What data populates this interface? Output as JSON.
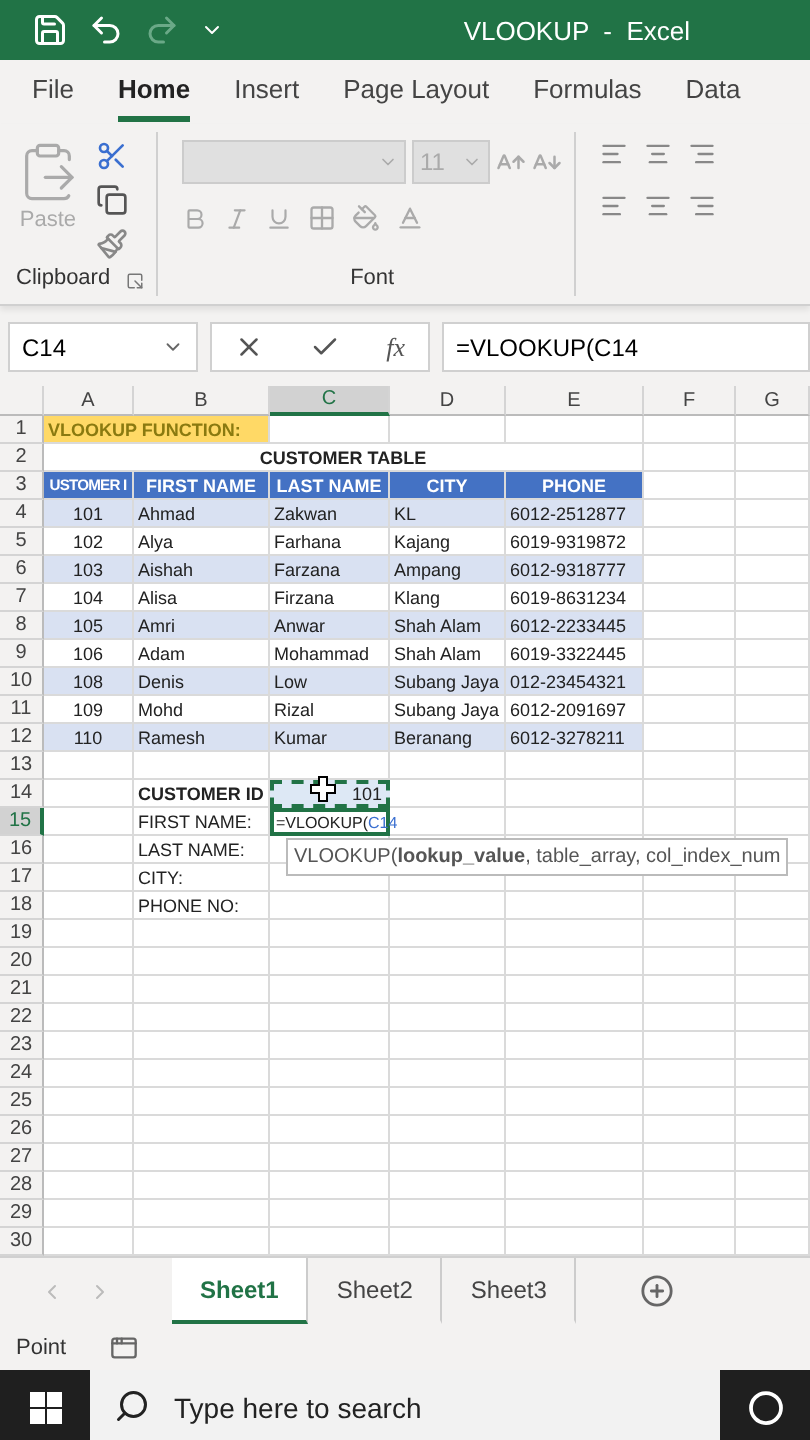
{
  "window": {
    "title": "VLOOKUP  -  Excel"
  },
  "ribbon_tabs": [
    {
      "label": "File",
      "selected": false
    },
    {
      "label": "Home",
      "selected": true
    },
    {
      "label": "Insert",
      "selected": false
    },
    {
      "label": "Page Layout",
      "selected": false
    },
    {
      "label": "Formulas",
      "selected": false
    },
    {
      "label": "Data",
      "selected": false
    }
  ],
  "ribbon": {
    "clipboard": {
      "paste_label": "Paste",
      "group_label": "Clipboard"
    },
    "font": {
      "font_size": "11",
      "group_label": "Font",
      "disabled": true
    }
  },
  "formula_bar": {
    "name_box": "C14",
    "function_label": "fx",
    "formula": "=VLOOKUP(C14"
  },
  "columns": [
    {
      "label": "A",
      "selected": false
    },
    {
      "label": "B",
      "selected": false
    },
    {
      "label": "C",
      "selected": true
    },
    {
      "label": "D",
      "selected": false
    },
    {
      "label": "E",
      "selected": false
    },
    {
      "label": "F",
      "selected": false
    },
    {
      "label": "G",
      "selected": false
    }
  ],
  "rows": [
    {
      "number": "1",
      "kind": "note",
      "selected": false,
      "text": "VLOOKUP FUNCTION:"
    },
    {
      "number": "2",
      "kind": "title",
      "selected": false,
      "text": "CUSTOMER TABLE"
    },
    {
      "number": "3",
      "kind": "header",
      "selected": false,
      "cells": [
        "USTOMER I",
        "FIRST NAME",
        "LAST NAME",
        "CITY",
        "PHONE"
      ]
    },
    {
      "number": "4",
      "kind": "record",
      "selected": false,
      "cells": [
        "101",
        "Ahmad",
        "Zakwan",
        "KL",
        "6012-2512877"
      ]
    },
    {
      "number": "5",
      "kind": "record",
      "selected": false,
      "cells": [
        "102",
        "Alya",
        "Farhana",
        "Kajang",
        "6019-9319872"
      ]
    },
    {
      "number": "6",
      "kind": "record",
      "selected": false,
      "cells": [
        "103",
        "Aishah",
        "Farzana",
        "Ampang",
        "6012-9318777"
      ]
    },
    {
      "number": "7",
      "kind": "record",
      "selected": false,
      "cells": [
        "104",
        "Alisa",
        "Firzana",
        "Klang",
        "6019-8631234"
      ]
    },
    {
      "number": "8",
      "kind": "record",
      "selected": false,
      "cells": [
        "105",
        "Amri",
        "Anwar",
        "Shah Alam",
        "6012-2233445"
      ]
    },
    {
      "number": "9",
      "kind": "record",
      "selected": false,
      "cells": [
        "106",
        "Adam",
        "Mohammad",
        "Shah Alam",
        "6019-3322445"
      ]
    },
    {
      "number": "10",
      "kind": "record",
      "selected": false,
      "cells": [
        "108",
        "Denis",
        "Low",
        "Subang Jaya",
        "012-23454321"
      ]
    },
    {
      "number": "11",
      "kind": "record",
      "selected": false,
      "cells": [
        "109",
        "Mohd",
        "Rizal",
        "Subang Jaya",
        "6012-2091697"
      ]
    },
    {
      "number": "12",
      "kind": "record",
      "selected": false,
      "cells": [
        "110",
        "Ramesh",
        "Kumar",
        "Beranang",
        "6012-3278211"
      ]
    },
    {
      "number": "13",
      "kind": "empty",
      "selected": false
    },
    {
      "number": "14",
      "kind": "form",
      "selected": false,
      "label": "CUSTOMER ID",
      "bold": true,
      "copied": true,
      "editing": false,
      "value": "101"
    },
    {
      "number": "15",
      "kind": "form",
      "selected": true,
      "label": "FIRST NAME:",
      "bold": false,
      "copied": false,
      "editing": true,
      "value": "=VLOOKUP(",
      "reference": "C14"
    },
    {
      "number": "16",
      "kind": "form",
      "selected": false,
      "label": "LAST NAME:",
      "bold": false,
      "copied": false,
      "editing": false
    },
    {
      "number": "17",
      "kind": "form",
      "selected": false,
      "label": "CITY:",
      "bold": false,
      "copied": false,
      "editing": false
    },
    {
      "number": "18",
      "kind": "form",
      "selected": false,
      "label": "PHONE NO:",
      "bold": false,
      "copied": false,
      "editing": false
    },
    {
      "number": "19",
      "kind": "empty",
      "selected": false
    },
    {
      "number": "20",
      "kind": "empty",
      "selected": false
    },
    {
      "number": "21",
      "kind": "empty",
      "selected": false
    },
    {
      "number": "22",
      "kind": "empty",
      "selected": false
    },
    {
      "number": "23",
      "kind": "empty",
      "selected": false
    },
    {
      "number": "24",
      "kind": "empty",
      "selected": false
    },
    {
      "number": "25",
      "kind": "empty",
      "selected": false
    },
    {
      "number": "26",
      "kind": "empty",
      "selected": false
    },
    {
      "number": "27",
      "kind": "empty",
      "selected": false
    },
    {
      "number": "28",
      "kind": "empty",
      "selected": false
    },
    {
      "number": "29",
      "kind": "empty",
      "selected": false
    },
    {
      "number": "30",
      "kind": "empty",
      "selected": false
    }
  ],
  "tooltip": "VLOOKUP(**lookup_value**, table_array, col_index_num",
  "sheet_tabs": [
    {
      "label": "Sheet1",
      "selected": true
    },
    {
      "label": "Sheet2",
      "selected": false
    },
    {
      "label": "Sheet3",
      "selected": false
    }
  ],
  "status_bar": {
    "mode": "Point"
  },
  "taskbar": {
    "search_placeholder": "Type here to search"
  }
}
